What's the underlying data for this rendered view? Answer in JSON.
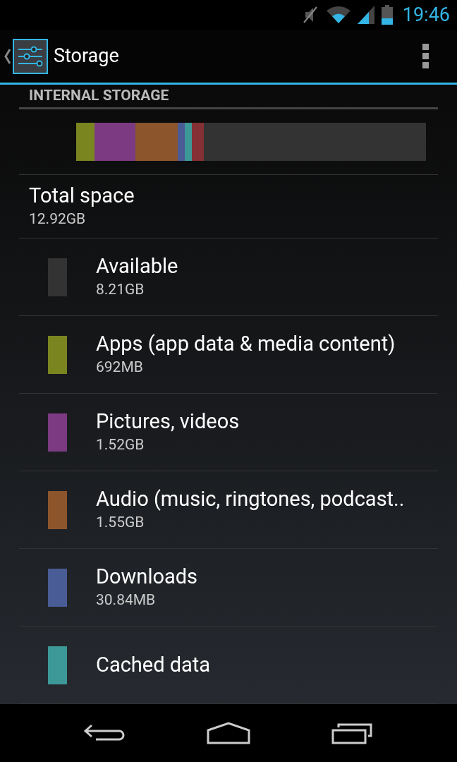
{
  "status_bar": {
    "time": "19:46"
  },
  "action_bar": {
    "title": "Storage"
  },
  "section": {
    "title": "INTERNAL STORAGE"
  },
  "usage_bar": {
    "segments": [
      {
        "color": "#7a8520"
      },
      {
        "color": "#7b3a82"
      },
      {
        "color": "#8c552c"
      },
      {
        "color": "#4a5c96"
      },
      {
        "color": "#3d9898"
      },
      {
        "color": "#853034"
      }
    ]
  },
  "total": {
    "title": "Total space",
    "value": "12.92GB"
  },
  "items": [
    {
      "title": "Available",
      "value": "8.21GB",
      "color": "#333333"
    },
    {
      "title": "Apps (app data & media content)",
      "value": "692MB",
      "color": "#7a8520"
    },
    {
      "title": "Pictures, videos",
      "value": "1.52GB",
      "color": "#7b3a82"
    },
    {
      "title": "Audio (music, ringtones, podcast..",
      "value": "1.55GB",
      "color": "#8c552c"
    },
    {
      "title": "Downloads",
      "value": "30.84MB",
      "color": "#4a5c96"
    },
    {
      "title": "Cached data",
      "color": "#3d9898"
    }
  ]
}
